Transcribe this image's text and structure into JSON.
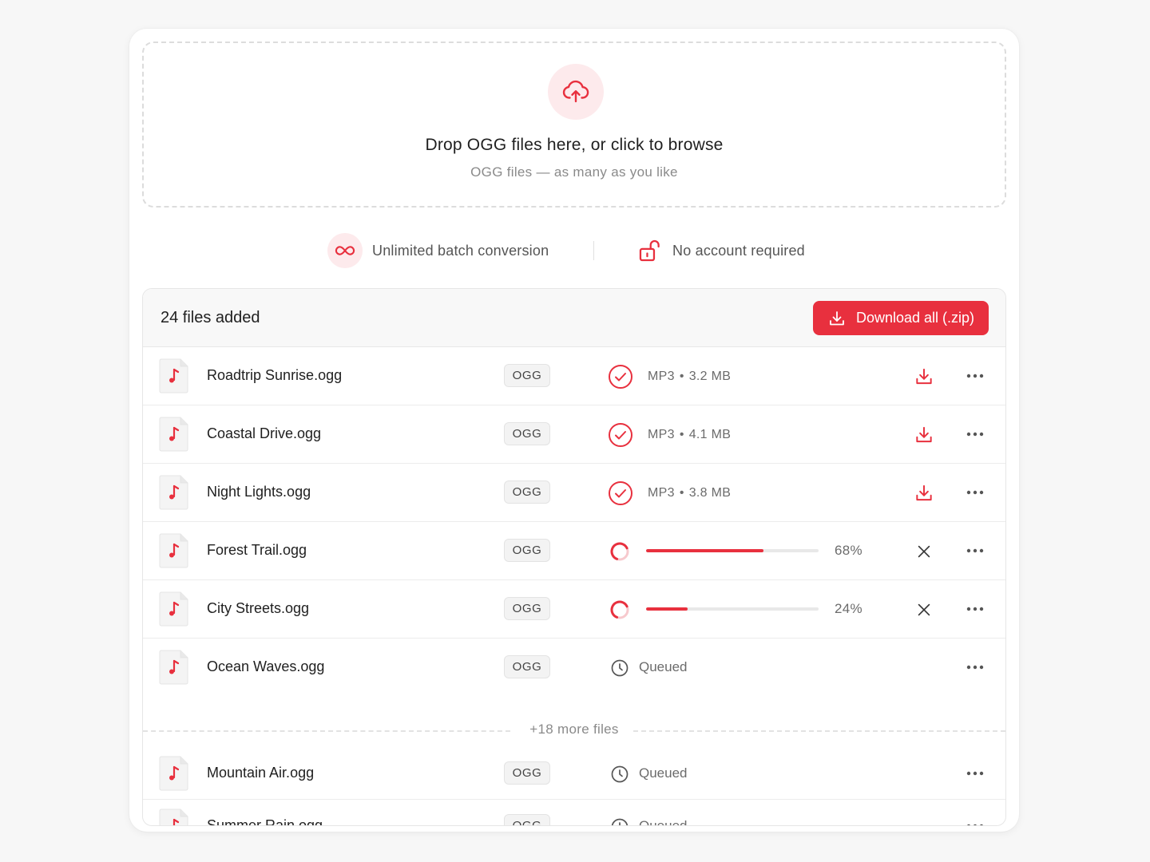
{
  "dropzone": {
    "icon": "cloud-upload-icon",
    "title": "Drop OGG files here, or click to browse",
    "subtitle": "OGG files — as many as you like"
  },
  "features": [
    {
      "icon": "infinity-icon",
      "label": "Unlimited batch conversion"
    },
    {
      "icon": "unlock-icon",
      "label": "No account required"
    }
  ],
  "list": {
    "count_label": "24 files added",
    "download_all_label": "Download all (.zip)",
    "more_files_label": "+18 more files",
    "badge": "OGG",
    "queued_label": "Queued",
    "rows": [
      {
        "name": "Roadtrip Sunrise.ogg",
        "status": "done",
        "out_format": "MP3",
        "size": "3.2 MB"
      },
      {
        "name": "Coastal Drive.ogg",
        "status": "done",
        "out_format": "MP3",
        "size": "4.1 MB"
      },
      {
        "name": "Night Lights.ogg",
        "status": "done",
        "out_format": "MP3",
        "size": "3.8 MB"
      },
      {
        "name": "Forest Trail.ogg",
        "status": "converting",
        "progress": 0.68,
        "progress_label": "68%"
      },
      {
        "name": "City Streets.ogg",
        "status": "converting",
        "progress": 0.24,
        "progress_label": "24%"
      },
      {
        "name": "Ocean Waves.ogg",
        "status": "queued"
      },
      {
        "name": "Mountain Air.ogg",
        "status": "queued"
      },
      {
        "name": "Summer Rain.ogg",
        "status": "queued"
      }
    ]
  },
  "colors": {
    "accent": "#e8303e",
    "accent_soft": "#fdeaec",
    "muted_text": "#6b6b6b"
  }
}
